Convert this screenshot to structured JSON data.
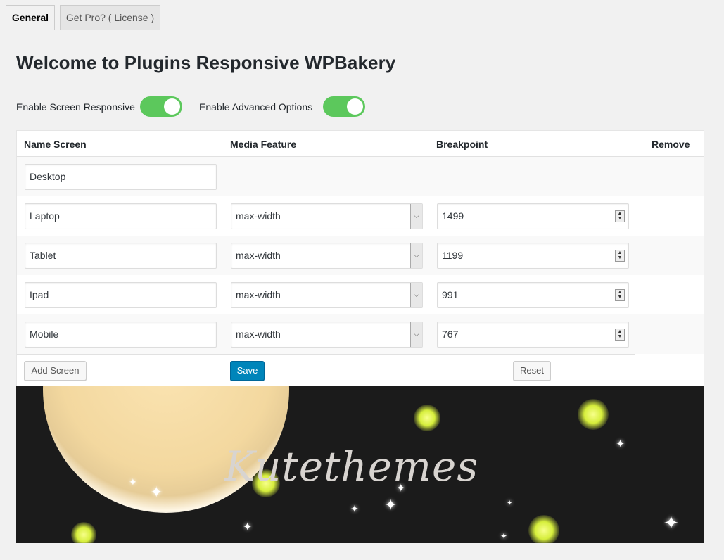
{
  "tabs": [
    {
      "label": "General"
    },
    {
      "label": "Get Pro? ( License )"
    }
  ],
  "page_title": "Welcome to Plugins Responsive WPBakery",
  "options": {
    "screen_responsive": {
      "label": "Enable Screen Responsive",
      "enabled": true
    },
    "advanced_options": {
      "label": "Enable Advanced Options",
      "enabled": true
    }
  },
  "colors": {
    "toggle_on": "#5cc85c",
    "primary_button": "#0085ba"
  },
  "table": {
    "headers": {
      "name": "Name Screen",
      "media": "Media Feature",
      "breakpoint": "Breakpoint",
      "remove": "Remove"
    },
    "rows": [
      {
        "name": "Desktop"
      },
      {
        "name": "Laptop",
        "media": "max-width",
        "breakpoint": "1499"
      },
      {
        "name": "Tablet",
        "media": "max-width",
        "breakpoint": "1199"
      },
      {
        "name": "Ipad",
        "media": "max-width",
        "breakpoint": "991"
      },
      {
        "name": "Mobile",
        "media": "max-width",
        "breakpoint": "767"
      }
    ]
  },
  "buttons": {
    "add_screen": "Add Screen",
    "save": "Save",
    "reset": "Reset"
  },
  "banner": {
    "brand": "Kutethemes"
  }
}
